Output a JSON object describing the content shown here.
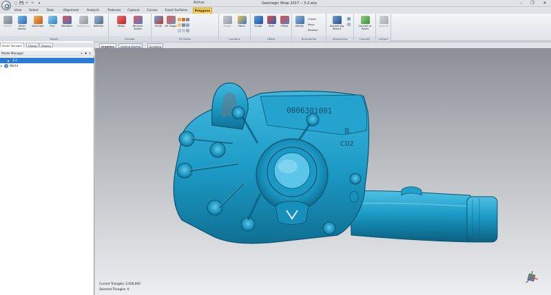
{
  "window": {
    "title": "Geomagic Wrap 2017 -- 3-2.wrp",
    "context_label": "Active",
    "minimize": "–",
    "maximize": "❐",
    "close": "✕"
  },
  "quick_access": [
    "▢",
    "💾",
    "↶",
    "↷",
    "▾"
  ],
  "tabs": [
    "View",
    "Select",
    "Tools",
    "Alignment",
    "Analysis",
    "Features",
    "Capture",
    "Curves",
    "Exact Surfaces",
    "Polygons"
  ],
  "search": {
    "placeholder": "Search"
  },
  "help": "?",
  "ribbon": {
    "groups": [
      {
        "label": "Repair",
        "buttons": [
          "Delete",
          "Mesh Doctor",
          "Decimate",
          "Fine",
          "Manifold",
          "Defeature",
          "Refinish"
        ]
      },
      {
        "label": "Smooth",
        "buttons": [
          "Relax",
          "Remove Spikes"
        ]
      },
      {
        "label": "Fill Holes",
        "buttons": [
          "Fill All",
          "Fill Single"
        ]
      },
      {
        "label": "Combine",
        "buttons": [
          "Merge",
          "Patch"
        ]
      },
      {
        "label": "Offset",
        "buttons": [
          "Sculpt",
          "Shell",
          "Offset"
        ]
      },
      {
        "label": "Boundaries",
        "buttons": [
          "Modify",
          "Create",
          "Move",
          "Remove"
        ]
      },
      {
        "label": "Sharpening",
        "buttons": [
          "Sharpening Wizard"
        ]
      },
      {
        "label": "Convert",
        "buttons": [
          "Convert to Points"
        ]
      },
      {
        "label": "Output",
        "buttons": [
          "Send To"
        ]
      }
    ]
  },
  "left_panel": {
    "tabs": [
      "Model Manager",
      "Dialog",
      "Display"
    ],
    "title": "Model Manager",
    "controls": [
      "▾",
      "✱",
      "✕"
    ],
    "tree": [
      {
        "label": "3-2",
        "selected": true
      },
      {
        "label": "World",
        "selected": false
      }
    ]
  },
  "viewport": {
    "tabs": [
      "Graphics",
      "Getting Started",
      "Scripting"
    ],
    "engraved_text": [
      "0006301001",
      "8.",
      "C02"
    ],
    "status": {
      "current_triangles": "Current Triangles: 2,000,000",
      "selected_triangles": "Selected Triangles: 0"
    }
  },
  "colors": {
    "model": "#1d9cc7",
    "model_dark": "#0d5f7d",
    "active_tab": "#fbd35a",
    "selection": "#2b7bd6"
  }
}
